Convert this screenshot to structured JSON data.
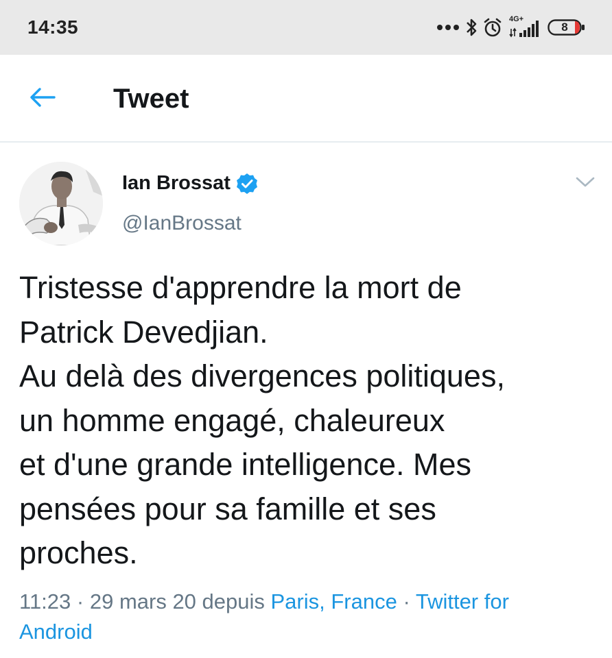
{
  "status_bar": {
    "time": "14:35",
    "network_label": "4G+",
    "battery_level": "8",
    "icons": [
      "more-dots-icon",
      "bluetooth-icon",
      "alarm-icon",
      "signal-icon",
      "battery-icon"
    ]
  },
  "header": {
    "back_icon": "back-arrow-icon",
    "title": "Tweet"
  },
  "tweet": {
    "author_name": "Ian Brossat",
    "author_handle": "@IanBrossat",
    "verified": true,
    "text_lines": [
      "Tristesse d'apprendre la mort de",
      "Patrick Devedjian.",
      "Au delà des divergences politiques,",
      "un homme engagé, chaleureux",
      "et d'une grande intelligence. Mes",
      "pensées pour sa famille et ses",
      "proches."
    ],
    "time": "11:23",
    "separator": " · ",
    "date": "29 mars 20",
    "depuis": " depuis ",
    "location": "Paris, France",
    "source_line1": "Twitter for",
    "source_line2": "Android"
  },
  "colors": {
    "link": "#1b95e0",
    "text": "#14171a",
    "secondary": "#657786",
    "status_bar_bg": "#e9e9e9"
  }
}
